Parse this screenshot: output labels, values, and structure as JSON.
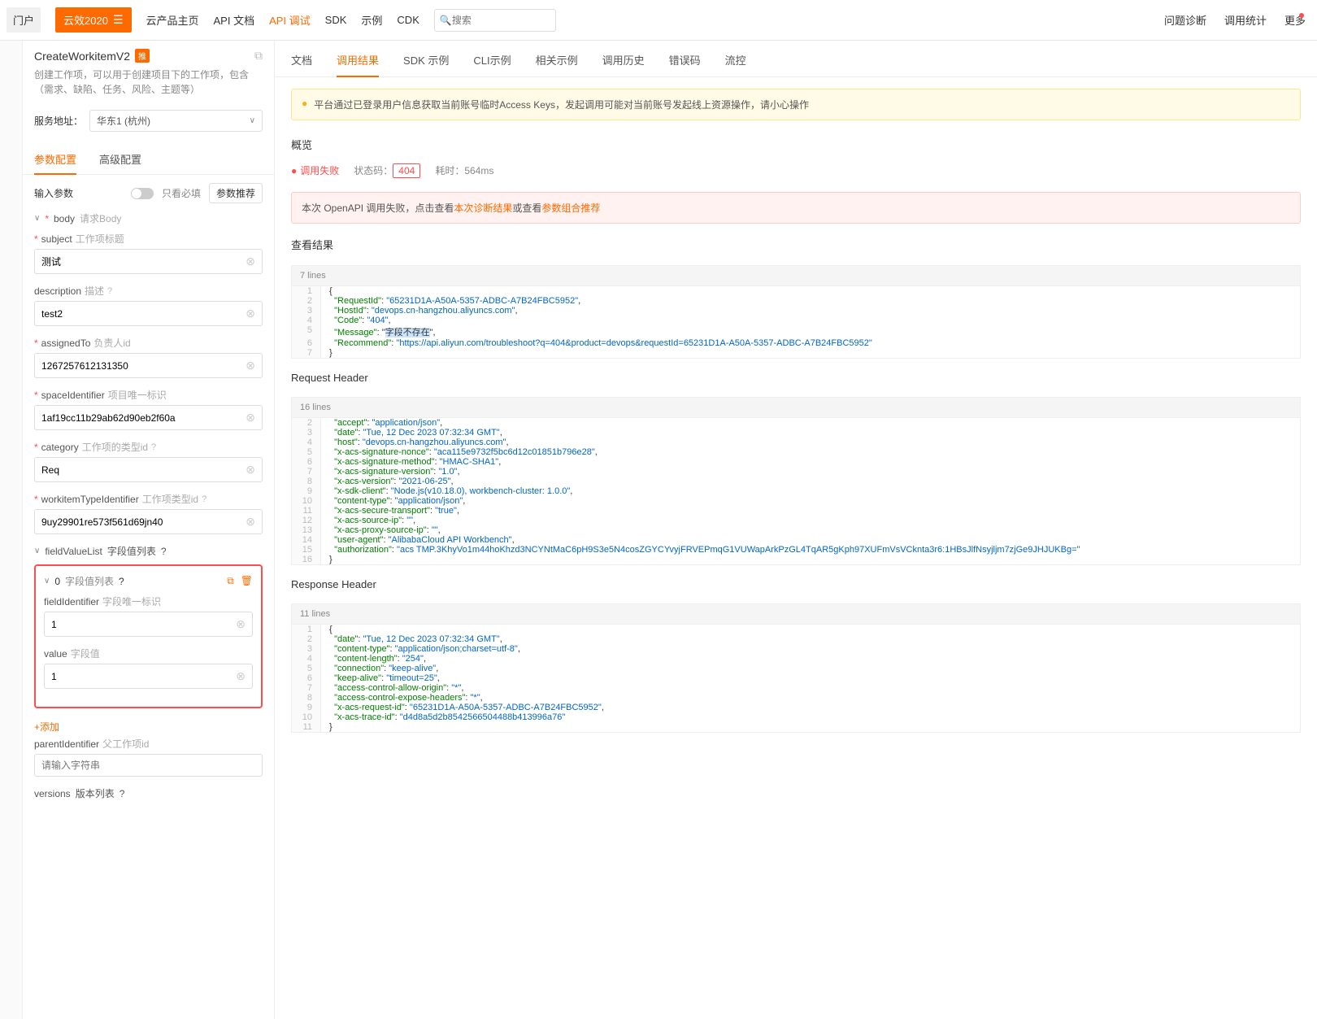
{
  "topnav": {
    "left_tag": "门户",
    "brand": "云效2020",
    "links": [
      "云产品主页",
      "API 文档",
      "API 调试",
      "SDK",
      "示例",
      "CDK"
    ],
    "search_placeholder": "搜索",
    "right": [
      "问题诊断",
      "调用统计",
      "更多"
    ]
  },
  "api": {
    "name": "CreateWorkitemV2",
    "badge": "推",
    "desc": "创建工作项，可以用于创建项目下的工作项，包含（需求、缺陷、任务、风险、主题等）"
  },
  "region": {
    "label": "服务地址：",
    "value": "华东1 (杭州)"
  },
  "subtabs": [
    "参数配置",
    "高级配置"
  ],
  "param_toolbar": {
    "title": "输入参数",
    "toggle_label": "只看必填",
    "recommend": "参数推荐"
  },
  "body_label": {
    "star": "*",
    "name": "body",
    "hint": "请求Body"
  },
  "fields": {
    "subject": {
      "label": "subject",
      "hint": "工作项标题",
      "value": "测试"
    },
    "description": {
      "label": "description",
      "hint": "描述",
      "value": "test2"
    },
    "assignedTo": {
      "label": "assignedTo",
      "hint": "负责人id",
      "value": "1267257612131350"
    },
    "spaceIdentifier": {
      "label": "spaceIdentifier",
      "hint": "项目唯一标识",
      "value": "1af19cc11b29ab62d90eb2f60a"
    },
    "category": {
      "label": "category",
      "hint": "工作项的类型id",
      "value": "Req"
    },
    "workitemTypeIdentifier": {
      "label": "workitemTypeIdentifier",
      "hint": "工作项类型id",
      "value": "9uy29901re573f561d69jn40"
    },
    "fieldValueList": {
      "label": "fieldValueList",
      "hint": "字段值列表"
    },
    "fieldIdentifier": {
      "label": "fieldIdentifier",
      "hint": "字段唯一标识",
      "value": "1"
    },
    "value": {
      "label": "value",
      "hint": "字段值",
      "value": "1"
    },
    "parentIdentifier": {
      "label": "parentIdentifier",
      "hint": "父工作项id",
      "placeholder": "请输入字符串"
    },
    "versions": {
      "label": "versions",
      "hint": "版本列表"
    }
  },
  "nested": {
    "index": "0",
    "title": "字段值列表",
    "add": "+添加"
  },
  "result_tabs": [
    "文档",
    "调用结果",
    "SDK 示例",
    "CLI示例",
    "相关示例",
    "调用历史",
    "错误码",
    "流控"
  ],
  "warn": "平台通过已登录用户信息获取当前账号临时Access Keys，发起调用可能对当前账号发起线上资源操作，请小心操作",
  "overview": "概览",
  "status": {
    "fail": "调用失败",
    "code_label": "状态码：",
    "code": "404",
    "time_label": "耗时：",
    "time": "564ms"
  },
  "fail_hint": {
    "pre": "本次 OpenAPI 调用失败，点击查看",
    "link1": "本次诊断结果",
    "mid": "或查看",
    "link2": "参数组合推荐"
  },
  "view_result": "查看结果",
  "result_code": {
    "head": "7 lines",
    "lines": [
      "{",
      "  \"RequestId\": \"65231D1A-A50A-5357-ADBC-A7B24FBC5952\",",
      "  \"HostId\": \"devops.cn-hangzhou.aliyuncs.com\",",
      "  \"Code\": \"404\",",
      "  \"Message\": \"字段不存在\",",
      "  \"Recommend\": \"https://api.aliyun.com/troubleshoot?q=404&product=devops&requestId=65231D1A-A50A-5357-ADBC-A7B24FBC5952\"",
      "}"
    ]
  },
  "req_header_title": "Request Header",
  "req_header": {
    "head": "16 lines",
    "start": 2,
    "lines": [
      "  \"accept\": \"application/json\",",
      "  \"date\": \"Tue, 12 Dec 2023 07:32:34 GMT\",",
      "  \"host\": \"devops.cn-hangzhou.aliyuncs.com\",",
      "  \"x-acs-signature-nonce\": \"aca115e9732f5bc6d12c01851b796e28\",",
      "  \"x-acs-signature-method\": \"HMAC-SHA1\",",
      "  \"x-acs-signature-version\": \"1.0\",",
      "  \"x-acs-version\": \"2021-06-25\",",
      "  \"x-sdk-client\": \"Node.js(v10.18.0), workbench-cluster: 1.0.0\",",
      "  \"content-type\": \"application/json\",",
      "  \"x-acs-secure-transport\": \"true\",",
      "  \"x-acs-source-ip\": \"\",",
      "  \"x-acs-proxy-source-ip\": \"\",",
      "  \"user-agent\": \"AlibabaCloud API Workbench\",",
      "  \"authorization\": \"acs TMP.3KhyVo1m44hoKhzd3NCYNtMaC6pH9S3e5N4cosZGYCYvyjFRVEPmqG1VUWapArkPzGL4TqAR5gKph97XUFmVsVCknta3r6:1HBsJlfNsyjljm7zjGe9JHJUKBg=\"",
      "}"
    ]
  },
  "resp_header_title": "Response Header",
  "resp_header": {
    "head": "11 lines",
    "lines": [
      "{",
      "  \"date\": \"Tue, 12 Dec 2023 07:32:34 GMT\",",
      "  \"content-type\": \"application/json;charset=utf-8\",",
      "  \"content-length\": \"254\",",
      "  \"connection\": \"keep-alive\",",
      "  \"keep-alive\": \"timeout=25\",",
      "  \"access-control-allow-origin\": \"*\",",
      "  \"access-control-expose-headers\": \"*\",",
      "  \"x-acs-request-id\": \"65231D1A-A50A-5357-ADBC-A7B24FBC5952\",",
      "  \"x-acs-trace-id\": \"d4d8a5d2b8542566504488b413996a76\"",
      "}"
    ]
  }
}
